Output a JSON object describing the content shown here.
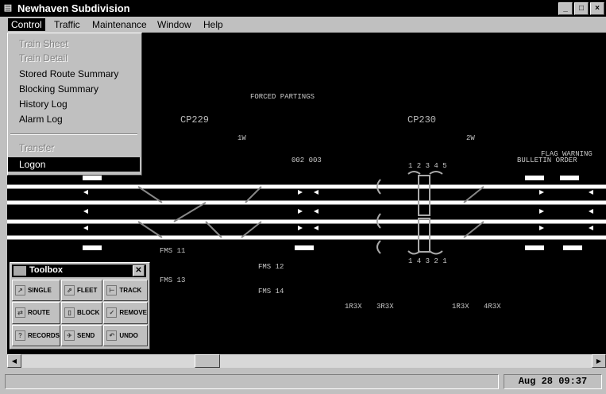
{
  "window": {
    "title": "Newhaven Subdivision",
    "buttons": [
      "_",
      "□",
      "×"
    ]
  },
  "menubar": {
    "items": [
      "Control",
      "Traffic",
      "Maintenance",
      "Window",
      "Help"
    ],
    "open": "Control"
  },
  "control_menu": {
    "items": [
      {
        "label": "Train Sheet",
        "enabled": false
      },
      {
        "label": "Train Detail",
        "enabled": false
      },
      {
        "label": "Stored Route Summary",
        "enabled": true
      },
      {
        "label": "Blocking Summary",
        "enabled": true
      },
      {
        "label": "History Log",
        "enabled": true
      },
      {
        "label": "Alarm Log",
        "enabled": true
      },
      {
        "label": "Transfer",
        "enabled": false
      },
      {
        "label": "Logon",
        "enabled": true,
        "selected": true
      }
    ]
  },
  "track_display": {
    "control_points": [
      "CP229",
      "CP230"
    ],
    "labels": {
      "forced_partings": "FORCED PARTINGS",
      "switch_ids": [
        "1W",
        "2W",
        "1W",
        "2W"
      ],
      "signal_group": "002 003",
      "track_numbers": [
        "1 2 3 4 5",
        "1 4 3 2 1"
      ],
      "bulletin": "BULLETIN ORDER",
      "flag_id": "FLAG WARNING",
      "bottom_codes": [
        "FMS 11",
        "FMS 12",
        "FMS 13",
        "FMS 14"
      ],
      "signal_text": [
        "1R3X",
        "3R3X",
        "1R3X",
        "4R3X"
      ]
    }
  },
  "toolbox": {
    "title": "Toolbox",
    "buttons": [
      {
        "label": "SINGLE",
        "icon": "single-icon"
      },
      {
        "label": "FLEET",
        "icon": "fleet-icon"
      },
      {
        "label": "TRACK",
        "icon": "track-icon"
      },
      {
        "label": "ROUTE",
        "icon": "route-icon"
      },
      {
        "label": "BLOCK",
        "icon": "block-icon"
      },
      {
        "label": "REMOVE",
        "icon": "remove-icon"
      },
      {
        "label": "RECORDS",
        "icon": "records-icon"
      },
      {
        "label": "SEND",
        "icon": "send-icon"
      },
      {
        "label": "UNDO",
        "icon": "undo-icon"
      }
    ]
  },
  "statusbar": {
    "message": "",
    "clock": "Aug 28 09:37"
  }
}
